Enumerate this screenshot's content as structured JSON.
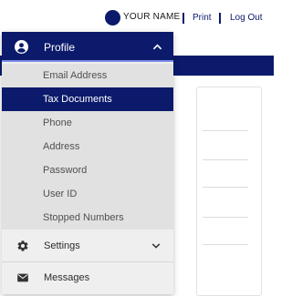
{
  "header": {
    "username": "YOUR NAME",
    "links": [
      {
        "label": "Print"
      },
      {
        "label": "Log Out"
      }
    ]
  },
  "menu": {
    "title": "Profile",
    "items": [
      {
        "label": "Email Address",
        "active": false
      },
      {
        "label": "Tax Documents",
        "active": true
      },
      {
        "label": "Phone",
        "active": false
      },
      {
        "label": "Address",
        "active": false
      },
      {
        "label": "Password",
        "active": false
      },
      {
        "label": "User ID",
        "active": false
      },
      {
        "label": "Stopped Numbers",
        "active": false
      }
    ],
    "settings": {
      "label": "Settings",
      "icon": "gear-icon"
    },
    "messages": {
      "label": "Messages",
      "icon": "envelope-icon"
    }
  },
  "colors": {
    "primary": "#0b1a6b",
    "accent_line": "#7c8ce6",
    "submenu_bg": "#e1e1e1",
    "menu_bg": "#efefef"
  },
  "icons": {
    "profile": "user-circle-icon",
    "collapse": "chevron-up-icon",
    "expand": "chevron-down-icon"
  }
}
